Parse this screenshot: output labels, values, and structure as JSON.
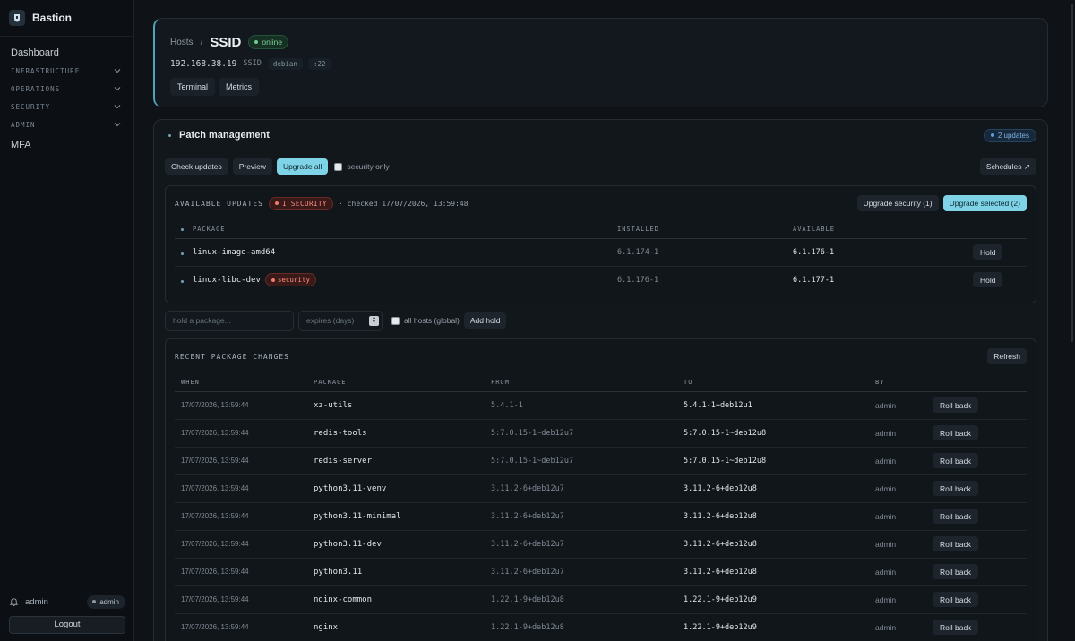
{
  "app": {
    "name": "Bastion"
  },
  "sidebar": {
    "dashboard": "Dashboard",
    "sections": [
      {
        "label": "INFRASTRUCTURE"
      },
      {
        "label": "OPERATIONS"
      },
      {
        "label": "SECURITY"
      },
      {
        "label": "ADMIN"
      }
    ],
    "mfa": "MFA",
    "user": {
      "name": "admin",
      "role": "admin"
    },
    "logout": "Logout"
  },
  "host": {
    "crumb": "Hosts",
    "sep": "/",
    "title": "SSID",
    "status": "online",
    "ip": "192.168.38.19",
    "name": "SSID",
    "os": "debian",
    "port": ":22",
    "actions": [
      "Terminal",
      "Metrics"
    ]
  },
  "patch": {
    "title": "Patch management",
    "updates_badge": "2 updates",
    "check_updates": "Check updates",
    "preview": "Preview",
    "upgrade_all": "Upgrade all",
    "security_only": "security only",
    "schedules": "Schedules ↗",
    "available": {
      "title": "AVAILABLE UPDATES",
      "security_badge": "1 SECURITY",
      "checked": "· checked 17/07/2026, 13:59:48",
      "upgrade_security": "Upgrade security (1)",
      "upgrade_selected": "Upgrade selected (2)",
      "headers": {
        "package": "PACKAGE",
        "installed": "INSTALLED",
        "available": "AVAILABLE"
      },
      "rows": [
        {
          "package": "linux-image-amd64",
          "security": "",
          "installed": "6.1.174-1",
          "available": "6.1.176-1",
          "action": "Hold"
        },
        {
          "package": "linux-libc-dev",
          "security": "security",
          "installed": "6.1.176-1",
          "available": "6.1.177-1",
          "action": "Hold"
        }
      ]
    },
    "hold": {
      "package_placeholder": "hold a package...",
      "expires_placeholder": "expires (days)",
      "all_hosts": "all hosts (global)",
      "add_hold": "Add hold"
    },
    "changes": {
      "title": "RECENT PACKAGE CHANGES",
      "refresh": "Refresh",
      "headers": {
        "when": "WHEN",
        "package": "PACKAGE",
        "from": "FROM",
        "to": "TO",
        "by": "BY"
      },
      "rows": [
        {
          "when": "17/07/2026, 13:59:44",
          "package": "xz-utils",
          "from": "5.4.1-1",
          "to": "5.4.1-1+deb12u1",
          "by": "admin",
          "action": "Roll back"
        },
        {
          "when": "17/07/2026, 13:59:44",
          "package": "redis-tools",
          "from": "5:7.0.15-1~deb12u7",
          "to": "5:7.0.15-1~deb12u8",
          "by": "admin",
          "action": "Roll back"
        },
        {
          "when": "17/07/2026, 13:59:44",
          "package": "redis-server",
          "from": "5:7.0.15-1~deb12u7",
          "to": "5:7.0.15-1~deb12u8",
          "by": "admin",
          "action": "Roll back"
        },
        {
          "when": "17/07/2026, 13:59:44",
          "package": "python3.11-venv",
          "from": "3.11.2-6+deb12u7",
          "to": "3.11.2-6+deb12u8",
          "by": "admin",
          "action": "Roll back"
        },
        {
          "when": "17/07/2026, 13:59:44",
          "package": "python3.11-minimal",
          "from": "3.11.2-6+deb12u7",
          "to": "3.11.2-6+deb12u8",
          "by": "admin",
          "action": "Roll back"
        },
        {
          "when": "17/07/2026, 13:59:44",
          "package": "python3.11-dev",
          "from": "3.11.2-6+deb12u7",
          "to": "3.11.2-6+deb12u8",
          "by": "admin",
          "action": "Roll back"
        },
        {
          "when": "17/07/2026, 13:59:44",
          "package": "python3.11",
          "from": "3.11.2-6+deb12u7",
          "to": "3.11.2-6+deb12u8",
          "by": "admin",
          "action": "Roll back"
        },
        {
          "when": "17/07/2026, 13:59:44",
          "package": "nginx-common",
          "from": "1.22.1-9+deb12u8",
          "to": "1.22.1-9+deb12u9",
          "by": "admin",
          "action": "Roll back"
        },
        {
          "when": "17/07/2026, 13:59:44",
          "package": "nginx",
          "from": "1.22.1-9+deb12u8",
          "to": "1.22.1-9+deb12u9",
          "by": "admin",
          "action": "Roll back"
        }
      ]
    }
  },
  "colors": {
    "accent": "#7fd3e6",
    "online": "#6fd091",
    "security": "#f07a6c",
    "updates": "#5fa0e0"
  }
}
